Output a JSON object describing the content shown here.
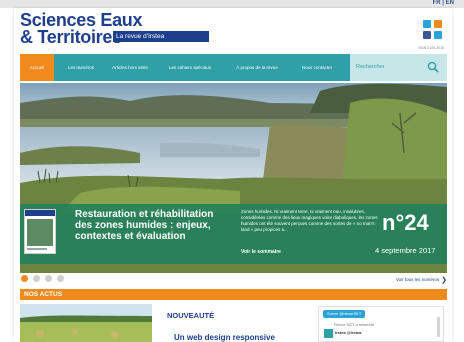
{
  "header": {
    "lang": "FR | EN",
    "logo_line1": "Sciences Eaux",
    "logo_line2": "& Territoires",
    "logo_tagline": "La revue d'Irstea",
    "issn": "ISSN 2109-3016"
  },
  "social": [
    {
      "name": "twitter-icon",
      "color": "#2aa3d8"
    },
    {
      "name": "rss-icon",
      "color": "#f08a1c"
    },
    {
      "name": "facebook-icon",
      "color": "#3b5998"
    },
    {
      "name": "social-icon",
      "color": "#2aa3d8"
    }
  ],
  "nav": {
    "items": [
      {
        "label": "Accueil"
      },
      {
        "label": "Les numéros"
      },
      {
        "label": "Articles hors série"
      },
      {
        "label": "Les cahiers spéciaux"
      },
      {
        "label": "À propos de la revue"
      },
      {
        "label": "Nous contacter"
      }
    ],
    "active_index": 0,
    "search_label": "Rechercher"
  },
  "hero": {
    "title": "Restauration et réhabilitation des zones humides : enjeux, contextes et évaluation",
    "text": "Zones humides. Ni vraiment terre, ni vraiment eau, insalubres, considérées comme des lieux magiques voire diaboliques, les zones humides ont été souvent perçues comme des sortes de « no man's land » peu propices a...",
    "summary_link": "Voir le sommaire",
    "issue_number": "n°24",
    "issue_date": "4 septembre 2017"
  },
  "carousel": {
    "dots": 4,
    "active": 0,
    "all_issues_link": "Voir tous les numéros"
  },
  "news": {
    "section_title": "NOS ACTUS",
    "tag": "NOUVEAUTÉ",
    "headline": "Un web design responsive"
  },
  "twitter": {
    "follow": "Suivre @revueSET",
    "retweet": "Revue SET a retweeté",
    "user": "Irstea @Irstea"
  },
  "colors": {
    "brand_blue": "#1e3f8c",
    "teal": "#2f9fa8",
    "orange": "#f08a1c",
    "caption_green": "#20805c"
  }
}
